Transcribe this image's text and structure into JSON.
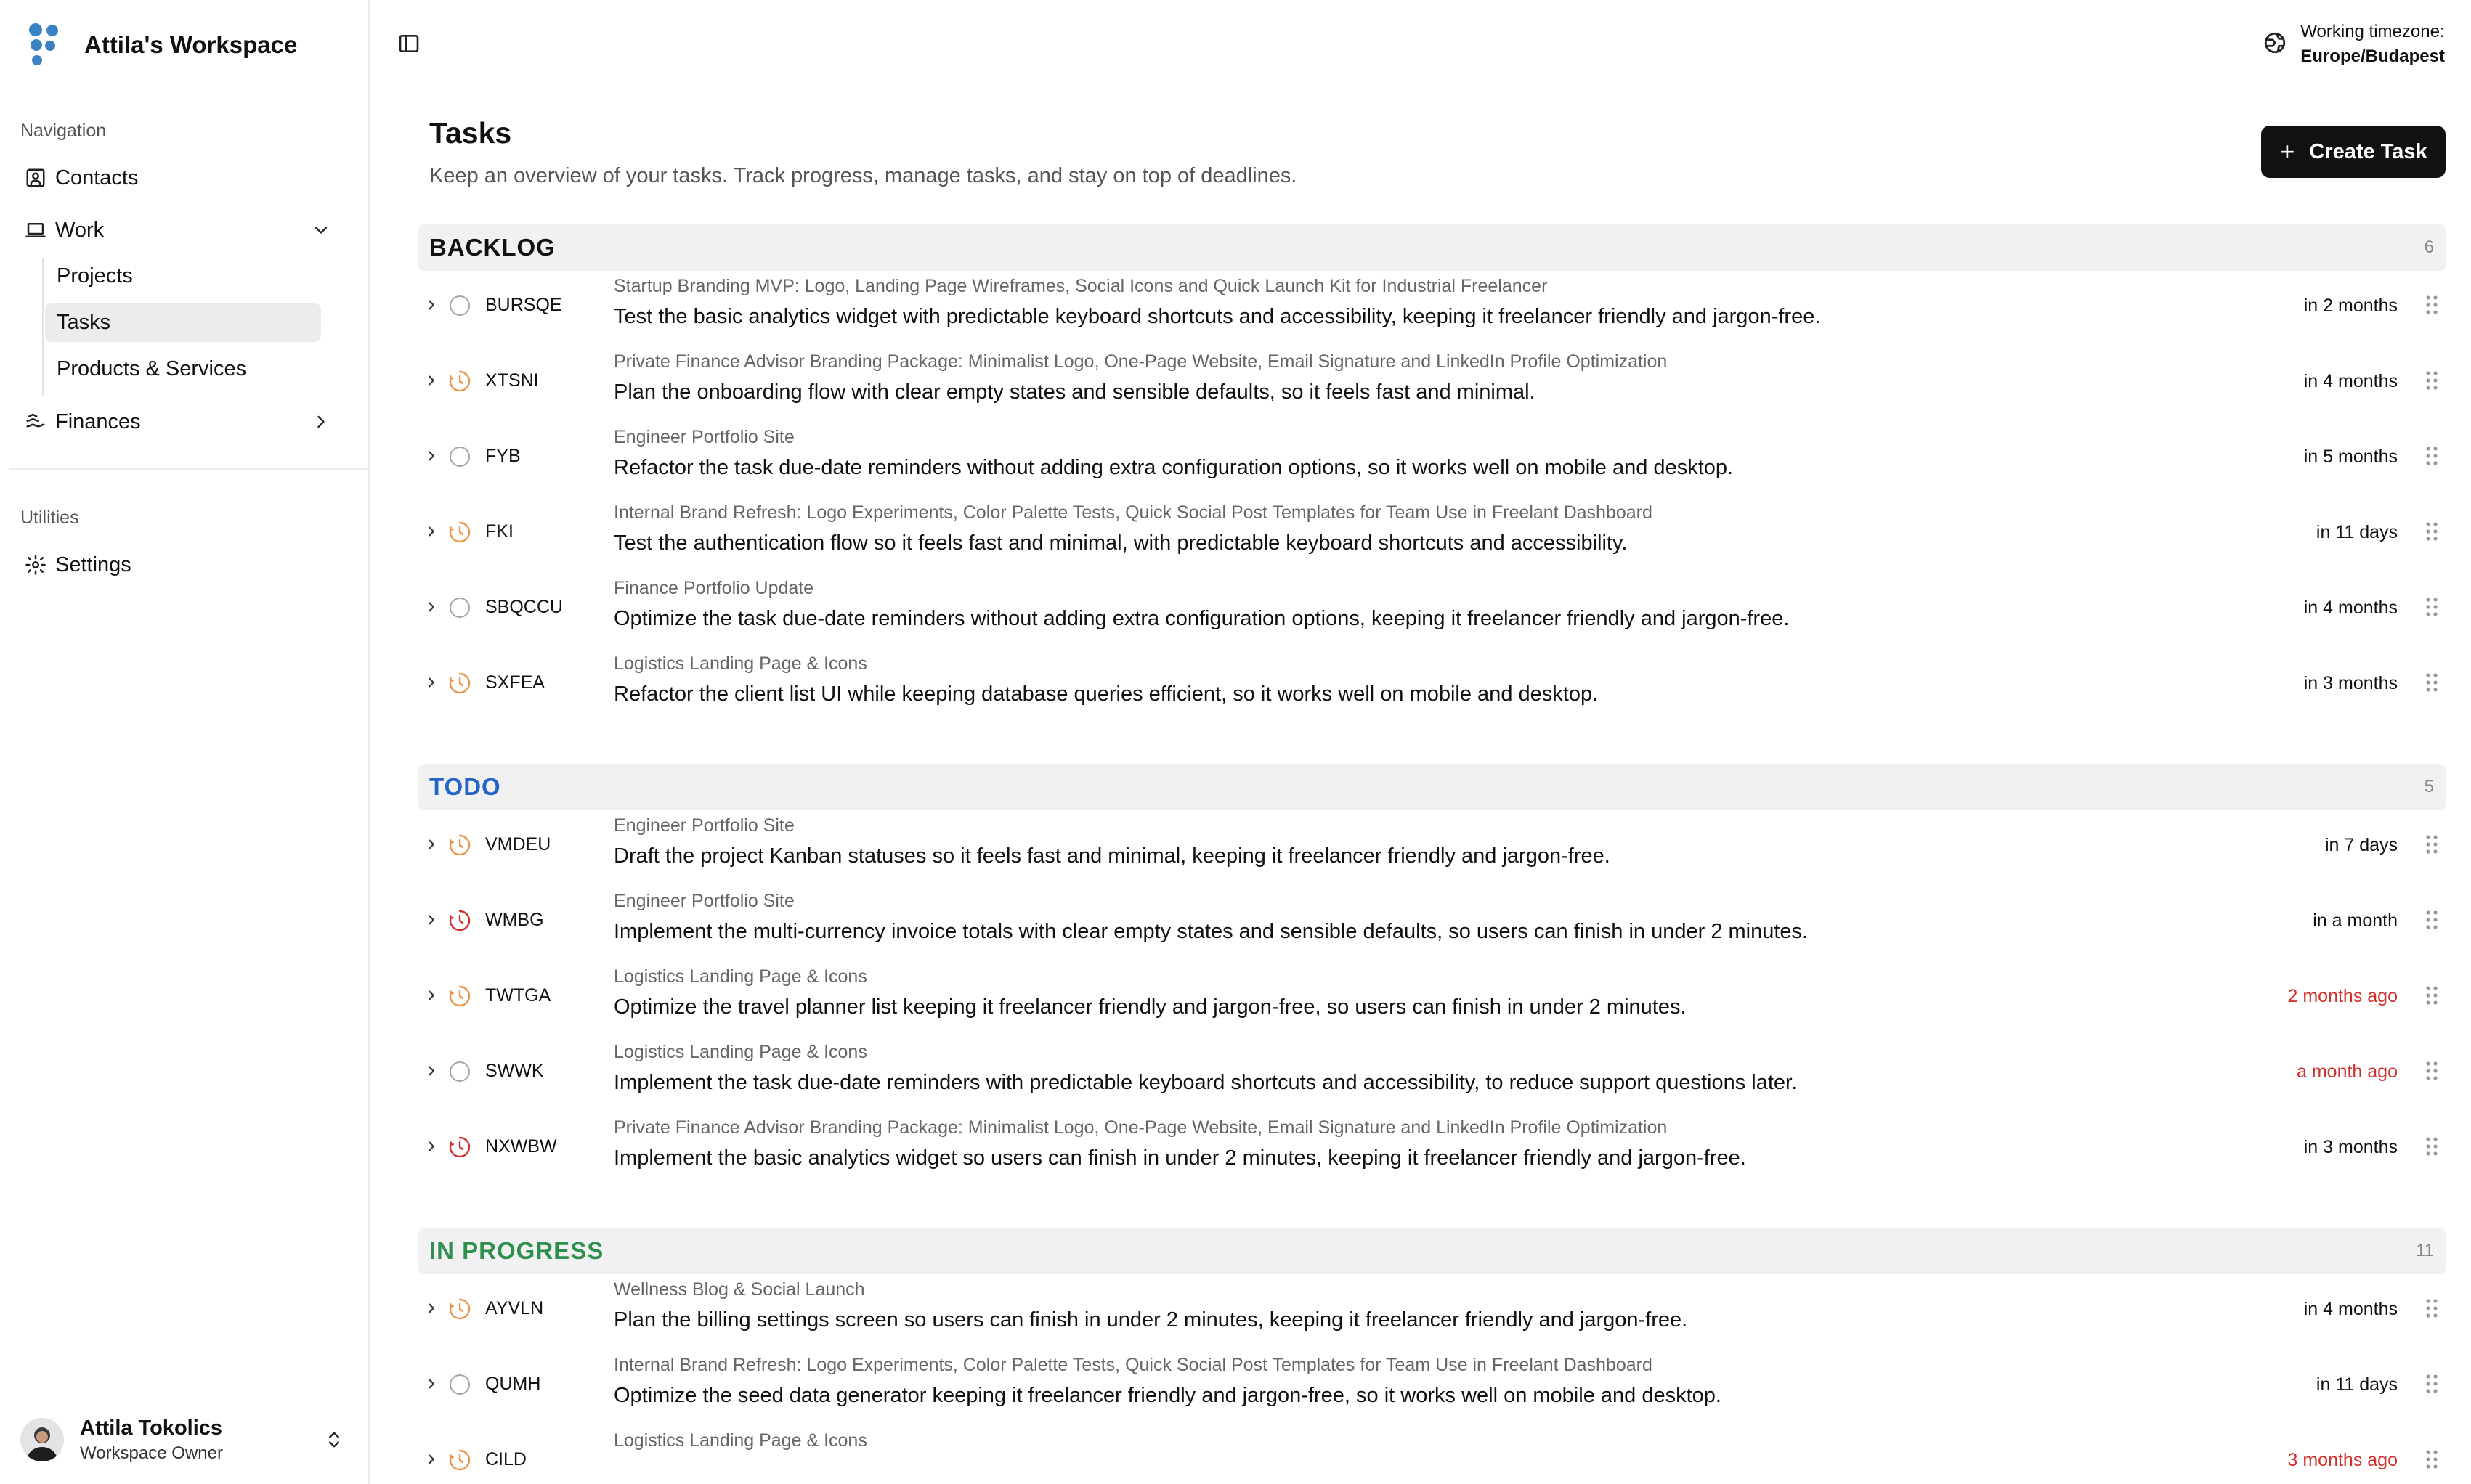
{
  "workspace": {
    "name": "Attila's Workspace"
  },
  "sidebar": {
    "navigation_heading": "Navigation",
    "contacts": "Contacts",
    "work": "Work",
    "work_items": [
      "Projects",
      "Tasks",
      "Products & Services"
    ],
    "finances": "Finances",
    "utilities_heading": "Utilities",
    "settings": "Settings"
  },
  "user": {
    "name": "Attila Tokolics",
    "role": "Workspace Owner"
  },
  "timezone": {
    "label": "Working timezone:",
    "value": "Europe/Budapest"
  },
  "page": {
    "title": "Tasks",
    "subtitle": "Keep an overview of your tasks. Track progress, manage tasks, and stay on top of deadlines.",
    "create_label": "Create Task"
  },
  "colors": {
    "backlog": "#111111",
    "todo": "#2563c9",
    "in_progress": "#2f8f4e",
    "warning": "#e8954a",
    "overdue": "#d0312d"
  },
  "groups": [
    {
      "name": "BACKLOG",
      "count": "6",
      "color": "#111111",
      "tasks": [
        {
          "code": "BURSQE",
          "status": "empty-circle-icon",
          "project": "Startup Branding MVP: Logo, Landing Page Wireframes, Social Icons and Quick Launch Kit for Industrial Freelancer",
          "title": "Test the basic analytics widget with predictable keyboard shortcuts and accessibility, keeping it freelancer friendly and jargon-free.",
          "due": "in 2 months",
          "overdue": false
        },
        {
          "code": "XTSNI",
          "status": "orange-clock-icon",
          "project": "Private Finance Advisor Branding Package: Minimalist Logo, One-Page Website, Email Signature and LinkedIn Profile Optimization",
          "title": "Plan the onboarding flow with clear empty states and sensible defaults, so it feels fast and minimal.",
          "due": "in 4 months",
          "overdue": false
        },
        {
          "code": "FYB",
          "status": "empty-circle-icon",
          "project": "Engineer Portfolio Site",
          "title": "Refactor the task due-date reminders without adding extra configuration options, so it works well on mobile and desktop.",
          "due": "in 5 months",
          "overdue": false
        },
        {
          "code": "FKI",
          "status": "orange-clock-icon",
          "project": "Internal Brand Refresh: Logo Experiments, Color Palette Tests, Quick Social Post Templates for Team Use in Freelant Dashboard",
          "title": "Test the authentication flow so it feels fast and minimal, with predictable keyboard shortcuts and accessibility.",
          "due": "in 11 days",
          "overdue": false
        },
        {
          "code": "SBQCCU",
          "status": "empty-circle-icon",
          "project": "Finance Portfolio Update",
          "title": "Optimize the task due-date reminders without adding extra configuration options, keeping it freelancer friendly and jargon-free.",
          "due": "in 4 months",
          "overdue": false
        },
        {
          "code": "SXFEA",
          "status": "orange-clock-icon",
          "project": "Logistics Landing Page & Icons",
          "title": "Refactor the client list UI while keeping database queries efficient, so it works well on mobile and desktop.",
          "due": "in 3 months",
          "overdue": false
        }
      ]
    },
    {
      "name": "TODO",
      "count": "5",
      "color": "#2563c9",
      "tasks": [
        {
          "code": "VMDEU",
          "status": "orange-clock-icon",
          "project": "Engineer Portfolio Site",
          "title": "Draft the project Kanban statuses so it feels fast and minimal, keeping it freelancer friendly and jargon-free.",
          "due": "in 7 days",
          "overdue": false
        },
        {
          "code": "WMBG",
          "status": "red-clock-icon",
          "project": "Engineer Portfolio Site",
          "title": "Implement the multi-currency invoice totals with clear empty states and sensible defaults, so users can finish in under 2 minutes.",
          "due": "in a month",
          "overdue": false
        },
        {
          "code": "TWTGA",
          "status": "orange-clock-icon",
          "project": "Logistics Landing Page & Icons",
          "title": "Optimize the travel planner list keeping it freelancer friendly and jargon-free, so users can finish in under 2 minutes.",
          "due": "2 months ago",
          "overdue": true
        },
        {
          "code": "SWWK",
          "status": "empty-circle-icon",
          "project": "Logistics Landing Page & Icons",
          "title": "Implement the task due-date reminders with predictable keyboard shortcuts and accessibility, to reduce support questions later.",
          "due": "a month ago",
          "overdue": true
        },
        {
          "code": "NXWBW",
          "status": "red-clock-icon",
          "project": "Private Finance Advisor Branding Package: Minimalist Logo, One-Page Website, Email Signature and LinkedIn Profile Optimization",
          "title": "Implement the basic analytics widget so users can finish in under 2 minutes, keeping it freelancer friendly and jargon-free.",
          "due": "in 3 months",
          "overdue": false
        }
      ]
    },
    {
      "name": "IN PROGRESS",
      "count": "11",
      "color": "#2f8f4e",
      "tasks": [
        {
          "code": "AYVLN",
          "status": "orange-clock-icon",
          "project": "Wellness Blog & Social Launch",
          "title": "Plan the billing settings screen so users can finish in under 2 minutes, keeping it freelancer friendly and jargon-free.",
          "due": "in 4 months",
          "overdue": false
        },
        {
          "code": "QUMH",
          "status": "empty-circle-icon",
          "project": "Internal Brand Refresh: Logo Experiments, Color Palette Tests, Quick Social Post Templates for Team Use in Freelant Dashboard",
          "title": "Optimize the seed data generator keeping it freelancer friendly and jargon-free, so it works well on mobile and desktop.",
          "due": "in 11 days",
          "overdue": false
        },
        {
          "code": "CILD",
          "status": "orange-clock-icon",
          "project": "Logistics Landing Page & Icons",
          "title": "",
          "due": "3 months ago",
          "overdue": true
        }
      ]
    }
  ]
}
